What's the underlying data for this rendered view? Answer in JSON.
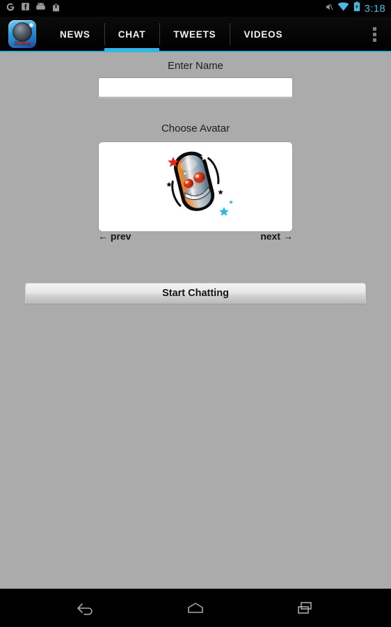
{
  "status_bar": {
    "notification_icons": [
      "google-g-icon",
      "facebook-icon",
      "android-robot-icon",
      "play-store-icon"
    ],
    "system_icons": [
      "mute-icon",
      "wifi-icon",
      "battery-charging-icon"
    ],
    "clock": "3:18",
    "accent_color": "#4fb8e0",
    "background": "#000000"
  },
  "action_bar": {
    "app_icon": {
      "name": "app-logo-icon",
      "wordmark": "Cinema"
    },
    "tabs": [
      {
        "label": "NEWS",
        "active": false
      },
      {
        "label": "CHAT",
        "active": true
      },
      {
        "label": "TWEETS",
        "active": false
      },
      {
        "label": "VIDEOS",
        "active": false
      }
    ],
    "active_tab": "CHAT",
    "accent_color": "#33b5e5",
    "overflow_icon": "overflow-menu-icon"
  },
  "main": {
    "name_label": "Enter Name",
    "name_value": "",
    "name_placeholder": "",
    "avatar_label": "Choose Avatar",
    "avatar": {
      "name": "robot-avatar-icon",
      "eye_color": "#d92a12",
      "body_color": "#cfcfcf",
      "accent_color": "#e8892a",
      "star_red": "#e02a1c",
      "star_cyan": "#33b5e5"
    },
    "prev_label": "← prev",
    "next_label": "next →",
    "start_button_label": "Start Chatting",
    "background": "#ababab"
  },
  "nav_bar": {
    "buttons": [
      {
        "name": "back-button",
        "icon": "back-arrow-icon"
      },
      {
        "name": "home-button",
        "icon": "home-icon"
      },
      {
        "name": "recents-button",
        "icon": "recents-icon"
      }
    ],
    "background": "#000000"
  }
}
